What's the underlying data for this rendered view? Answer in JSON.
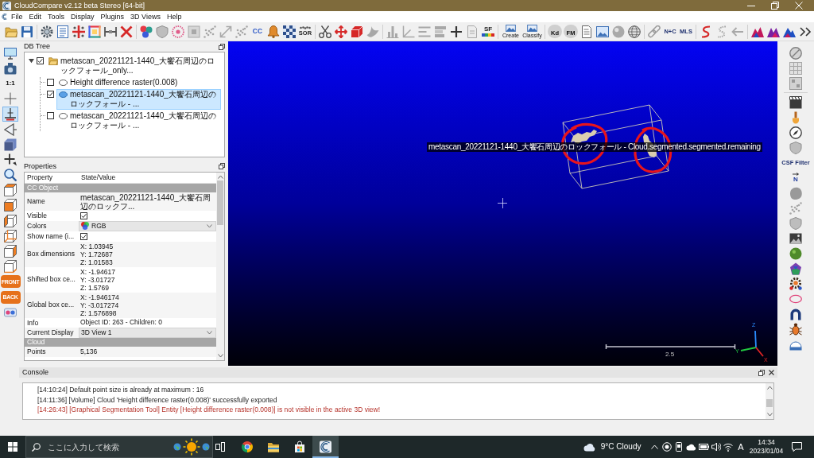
{
  "window": {
    "title": "CloudCompare v2.12 beta Stereo [64-bit]"
  },
  "menu": [
    "File",
    "Edit",
    "Tools",
    "Display",
    "Plugins",
    "3D Views",
    "Help"
  ],
  "toolbar": {
    "text_buttons": [
      "CC",
      "SOR",
      "SF",
      "Create",
      "Classify",
      "Kd",
      "FM",
      "N+C",
      "MLS"
    ]
  },
  "left_toolbar": [
    {
      "selected": false
    },
    {
      "selected": false
    },
    {
      "label": "1:1",
      "selected": false
    },
    {
      "selected": false
    },
    {
      "selected": true
    },
    {
      "selected": false
    },
    {
      "selected": false
    },
    {
      "selected": false
    },
    {
      "selected": false
    },
    {
      "selected": false
    },
    {
      "selected": false
    },
    {
      "selected": false
    },
    {
      "selected": false
    },
    {
      "selected": false
    },
    {
      "selected": false
    },
    {
      "label": "FRONT",
      "selected": false
    },
    {
      "label": "BACK",
      "selected": false
    },
    {
      "selected": false
    }
  ],
  "db_tree": {
    "title": "DB Tree",
    "items": [
      {
        "kind": "folder",
        "label": "metascan_20221121-1440_大饗石周辺のロックフォール_only...",
        "checked": true,
        "expanded": true,
        "selected": false,
        "children": [
          {
            "kind": "cloud",
            "label": "Height difference raster(0.008)",
            "checked": false,
            "selected": false
          },
          {
            "kind": "cloud",
            "label": "metascan_20221121-1440_大饗石周辺のロックフォール - ...",
            "checked": true,
            "selected": true
          },
          {
            "kind": "cloud",
            "label": "metascan_20221121-1440_大饗石周辺のロックフォール - ...",
            "checked": false,
            "selected": false
          }
        ]
      }
    ]
  },
  "properties": {
    "title": "Properties",
    "columns": [
      "Property",
      "State/Value"
    ],
    "rows": [
      {
        "kind": "section",
        "label": "CC Object"
      },
      {
        "kind": "text",
        "name": "Name",
        "value": "metascan_20221121-1440_大饗石周辺のロックフ..."
      },
      {
        "kind": "checkbox",
        "name": "Visible",
        "checked": true
      },
      {
        "kind": "color_select",
        "name": "Colors",
        "value": "RGB"
      },
      {
        "kind": "checkbox",
        "name": "Show name (i...",
        "checked": true
      },
      {
        "kind": "lines",
        "name": "Box dimensions",
        "lines": [
          "X: 1.03945",
          "Y: 1.72687",
          "Z: 1.01583"
        ]
      },
      {
        "kind": "lines",
        "name": "Shifted box ce...",
        "lines": [
          "X: -1.94617",
          "Y: -3.01727",
          "Z: 1.5769"
        ]
      },
      {
        "kind": "lines",
        "name": "Global box ce...",
        "lines": [
          "X: -1.946174",
          "Y: -3.017274",
          "Z: 1.576898"
        ]
      },
      {
        "kind": "text",
        "name": "Info",
        "value": "Object ID: 263 - Children: 0"
      },
      {
        "kind": "select",
        "name": "Current Display",
        "value": "3D View 1"
      },
      {
        "kind": "section",
        "label": "Cloud"
      },
      {
        "kind": "text",
        "name": "Points",
        "value": "5,136"
      }
    ]
  },
  "view3d": {
    "label": "metascan_20221121-1440_大饗石周辺のロックフォール - Cloud.segmented.segmented.remaining",
    "scale": "2.5",
    "axes": [
      {
        "label": "Z",
        "color": "#2a8cff"
      },
      {
        "label": "Y",
        "color": "#22c840"
      },
      {
        "label": "X",
        "color": "#e02424"
      }
    ]
  },
  "right_toolbar": {
    "text_buttons": [
      "CSF Filter",
      "N"
    ]
  },
  "console": {
    "title": "Console",
    "lines": [
      {
        "kind": "info",
        "text": "[14:10:24] Default point size is already at maximum : 16"
      },
      {
        "kind": "info",
        "text": "[14:11:36] [Volume] Cloud 'Height difference raster(0.008)' successfully exported"
      },
      {
        "kind": "error",
        "text": "[14:26:43] [Graphical Segmentation Tool] Entity [Height difference raster(0.008)] is not visible in the active 3D view!"
      }
    ]
  },
  "taskbar": {
    "search": {
      "placeholder": "ここに入力して検索"
    },
    "apps": [
      {
        "selected": false
      },
      {
        "selected": false
      },
      {
        "selected": false
      },
      {
        "selected": true
      }
    ],
    "weather": "9°C Cloudy",
    "input_indicator": "A",
    "time": "14:34",
    "date": "2023/01/04"
  }
}
